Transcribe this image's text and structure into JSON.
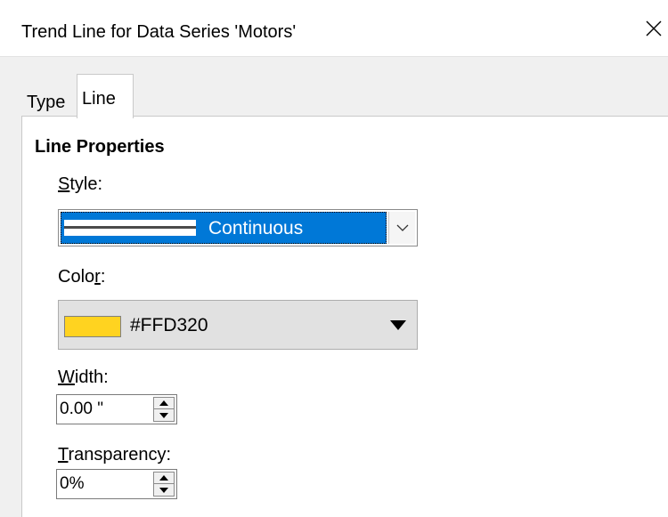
{
  "window": {
    "title": "Trend Line for Data Series 'Motors'"
  },
  "tabs": [
    {
      "label": "Type",
      "active": false
    },
    {
      "label": "Line",
      "active": true
    }
  ],
  "line_properties": {
    "section_title": "Line Properties",
    "style": {
      "label_prefix": "",
      "label_accel": "S",
      "label_rest": "tyle:",
      "value": "Continuous"
    },
    "color": {
      "label_prefix": "Colo",
      "label_accel": "r",
      "label_rest": ":",
      "value": "#FFD320",
      "swatch_color": "#FFD320"
    },
    "width": {
      "label_prefix": "",
      "label_accel": "W",
      "label_rest": "idth:",
      "value": "0.00 \""
    },
    "transparency": {
      "label_prefix": "",
      "label_accel": "T",
      "label_rest": "ransparency:",
      "value": "0%"
    }
  },
  "colors": {
    "selection": "#0078d7",
    "swatch": "#FFD320"
  }
}
